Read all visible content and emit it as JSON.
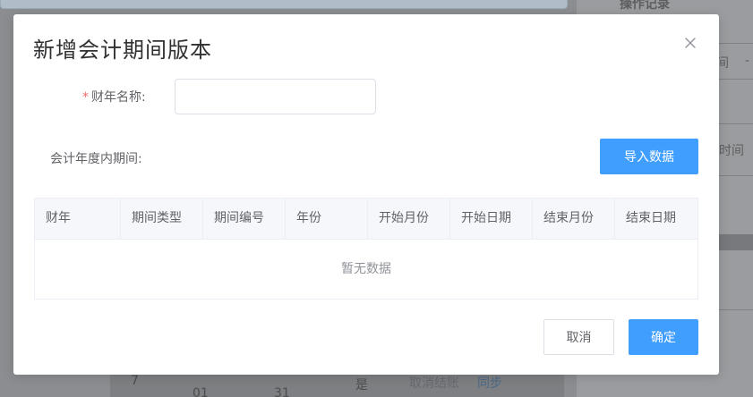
{
  "background": {
    "right_panel_title": "操作记录",
    "right_panel_rows": [
      "间",
      "-",
      "时间"
    ],
    "table_cells": [
      "7",
      "01",
      "31",
      "是"
    ],
    "bottom_actions": [
      "取消结账",
      "同步"
    ]
  },
  "dialog": {
    "title": "新增会计期间版本",
    "fiscal_year_label": "财年名称:",
    "fiscal_year_required_mark": "*",
    "fiscal_year_value": "",
    "fiscal_year_placeholder": "",
    "period_label": "会计年度内期间:",
    "import_button": "导入数据",
    "table": {
      "columns": [
        "财年",
        "期间类型",
        "期间编号",
        "年份",
        "开始月份",
        "开始日期",
        "结束月份",
        "结束日期"
      ],
      "rows": [],
      "empty_text": "暂无数据"
    },
    "cancel_button": "取消",
    "confirm_button": "确定"
  },
  "colors": {
    "primary": "#409eff",
    "required": "#f56c6c",
    "overlay": "#8b8d90"
  }
}
